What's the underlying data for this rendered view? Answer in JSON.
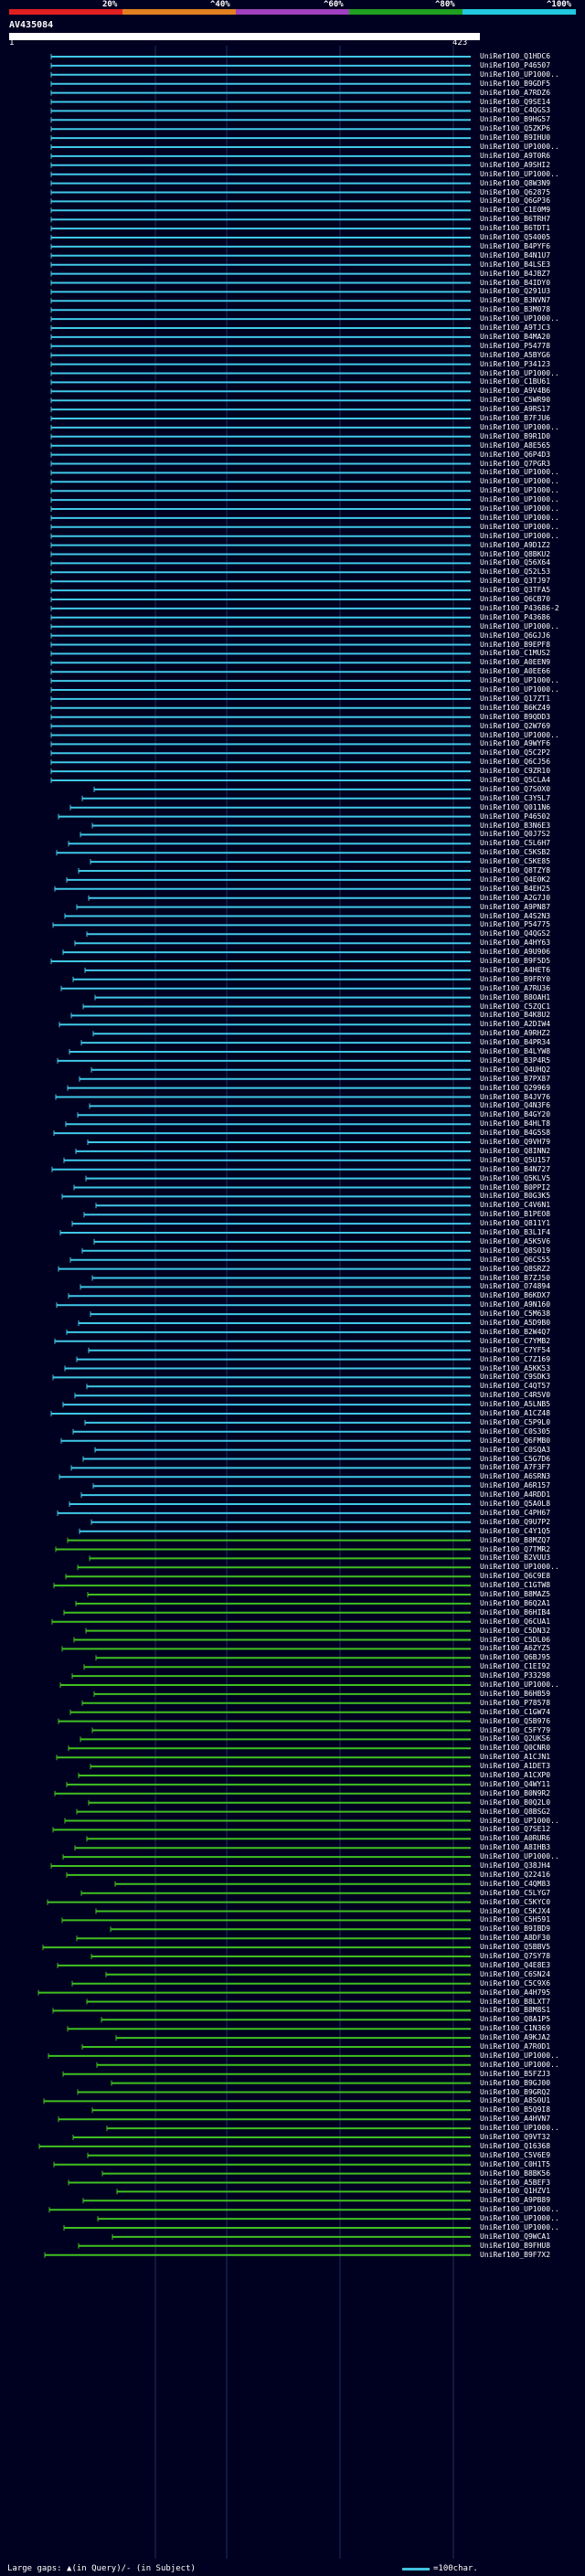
{
  "query": {
    "id": "AV435084",
    "start": "1",
    "end": "423"
  },
  "scale": {
    "ticks": [
      "20%",
      "^40%",
      "^60%",
      "^80%",
      "^100%"
    ]
  },
  "legend": {
    "gaps": "Large gaps: ▲(in Query)/- (in Subject)",
    "scale_note": "=100char."
  },
  "colors": {
    "cyan": "#40c8e8",
    "green": "#40c020",
    "bg": "#000020"
  },
  "hits": [
    "UniRef100_Q1HDC6",
    "UniRef100_P46507",
    "UniRef100_UP1000..",
    "UniRef100_B9GDF5",
    "UniRef100_A7RDZ6",
    "UniRef100_Q9SE14",
    "UniRef100_C4QGS3",
    "UniRef100_B9HG57",
    "UniRef100_Q5ZKP6",
    "UniRef100_B9IHU0",
    "UniRef100_UP1000..",
    "UniRef100_A9T0R6",
    "UniRef100_A9SHI2",
    "UniRef100_UP1000..",
    "UniRef100_Q8W3N9",
    "UniRef100_Q62875",
    "UniRef100_Q6GP36",
    "UniRef100_C1E0M9",
    "UniRef100_B6TRH7",
    "UniRef100_B6TDT1",
    "UniRef100_Q54005",
    "UniRef100_B4PYF6",
    "UniRef100_B4N1U7",
    "UniRef100_B4LSE3",
    "UniRef100_B4JBZ7",
    "UniRef100_B4IDY0",
    "UniRef100_Q291U3",
    "UniRef100_B3NVN7",
    "UniRef100_B3M078",
    "UniRef100_UP1000..",
    "UniRef100_A9TJC3",
    "UniRef100_B4MA20",
    "UniRef100_P54778",
    "UniRef100_A5BYG6",
    "UniRef100_P34123",
    "UniRef100_UP1000..",
    "UniRef100_C1BU61",
    "UniRef100_A9V4B6",
    "UniRef100_C5WR90",
    "UniRef100_A9RS17",
    "UniRef100_B7FJU6",
    "UniRef100_UP1000..",
    "UniRef100_B9R1D0",
    "UniRef100_A8E565",
    "UniRef100_Q6P4D3",
    "UniRef100_Q7PGR3",
    "UniRef100_UP1000..",
    "UniRef100_UP1000..",
    "UniRef100_UP1000..",
    "UniRef100_UP1000..",
    "UniRef100_UP1000..",
    "UniRef100_UP1000..",
    "UniRef100_UP1000..",
    "UniRef100_UP1000..",
    "UniRef100_A9D1Z2",
    "UniRef100_Q8BKU2",
    "UniRef100_Q56X64",
    "UniRef100_Q52L53",
    "UniRef100_Q3TJ97",
    "UniRef100_Q3TFA5",
    "UniRef100_Q6CB70",
    "UniRef100_P43686-2",
    "UniRef100_P43686",
    "UniRef100_UP1000..",
    "UniRef100_Q6GJJ6",
    "UniRef100_B9EPF8",
    "UniRef100_C1MUS2",
    "UniRef100_A0EEN9",
    "UniRef100_A0EE66",
    "UniRef100_UP1000..",
    "UniRef100_UP1000..",
    "UniRef100_Q17ZT1",
    "UniRef100_B6KZ49",
    "UniRef100_B9QDD3",
    "UniRef100_Q2W769",
    "UniRef100_UP1000..",
    "UniRef100_A9WYF6",
    "UniRef100_Q5C2P2",
    "UniRef100_Q6CJ56",
    "UniRef100_C9ZR10",
    "UniRef100_Q5CLA4",
    "UniRef100_Q7S0X0",
    "UniRef100_C3Y5L7",
    "UniRef100_Q011N6",
    "UniRef100_P46502",
    "UniRef100_B3N6E3",
    "UniRef100_Q0J7S2",
    "UniRef100_C5L6H7",
    "UniRef100_C5KSB2",
    "UniRef100_C5KE85",
    "UniRef100_Q8TZY8",
    "UniRef100_Q4E0K2",
    "UniRef100_B4EH25",
    "UniRef100_A2G7J0",
    "UniRef100_A9PN87",
    "UniRef100_A4S2N3",
    "UniRef100_P54775",
    "UniRef100_Q4QGS2",
    "UniRef100_A4HY63",
    "UniRef100_A9U906",
    "UniRef100_B9F5D5",
    "UniRef100_A4HET6",
    "UniRef100_B9FRY0",
    "UniRef100_A7RU36",
    "UniRef100_B8OAH1",
    "UniRef100_C5ZQC1",
    "UniRef100_B4K8U2",
    "UniRef100_A2DIW4",
    "UniRef100_A9RHZ2",
    "UniRef100_B4PR34",
    "UniRef100_B4LYW8",
    "UniRef100_B3P4R5",
    "UniRef100_Q4UHQ2",
    "UniRef100_B7PX87",
    "UniRef100_Q29969",
    "UniRef100_B4JV76",
    "UniRef100_Q4N3F6",
    "UniRef100_B4GY20",
    "UniRef100_B4HLT8",
    "UniRef100_B4G5S8",
    "UniRef100_Q9VH79",
    "UniRef100_Q8INN2",
    "UniRef100_Q5U157",
    "UniRef100_B4N727",
    "UniRef100_Q5KLV5",
    "UniRef100_B0PPI2",
    "UniRef100_B0G3K5",
    "UniRef100_C4V6N1",
    "UniRef100_B1PEO8",
    "UniRef100_Q811Y1",
    "UniRef100_B3L1F4",
    "UniRef100_A5K5V6",
    "UniRef100_Q8S019",
    "UniRef100_Q6CS55",
    "UniRef100_Q8SRZ2",
    "UniRef100_B7ZJ50",
    "UniRef100_O74894",
    "UniRef100_B6KDX7",
    "UniRef100_A9N160",
    "UniRef100_C5M638",
    "UniRef100_A5D9B0",
    "UniRef100_B2W4Q7",
    "UniRef100_C7YMB2",
    "UniRef100_C7YF54",
    "UniRef100_C7Z169",
    "UniRef100_A5KK53",
    "UniRef100_C9SDK3",
    "UniRef100_C4QT57",
    "UniRef100_C4R5V0",
    "UniRef100_A5LNB5",
    "UniRef100_A1CZ48",
    "UniRef100_C5P9L0",
    "UniRef100_C0S305",
    "UniRef100_Q6FMB0",
    "UniRef100_C0SQA3",
    "UniRef100_C5G7D6",
    "UniRef100_A7F3F7",
    "UniRef100_A6SRN3",
    "UniRef100_A6R157",
    "UniRef100_A4RDD1",
    "UniRef100_Q5A0L8",
    "UniRef100_C4PH67",
    "UniRef100_Q9U7P2",
    "UniRef100_C4Y1Q5",
    "UniRef100_B8MZQ7",
    "UniRef100_Q7TMR2",
    "UniRef100_B2VUU3",
    "UniRef100_UP1000..",
    "UniRef100_Q6C9E8",
    "UniRef100_C1GTW8",
    "UniRef100_B8MAZ5",
    "UniRef100_B6Q2A1",
    "UniRef100_B6HIB4",
    "UniRef100_Q6CUA1",
    "UniRef100_C5DN32",
    "UniRef100_C5DL06",
    "UniRef100_A6ZYZ5",
    "UniRef100_Q6BJ95",
    "UniRef100_C1EI92",
    "UniRef100_P33298",
    "UniRef100_UP1000..",
    "UniRef100_B6HB59",
    "UniRef100_P78578",
    "UniRef100_C1GW74",
    "UniRef100_Q5B976",
    "UniRef100_C5FY79",
    "UniRef100_Q2UKS6",
    "UniRef100_Q0CNR0",
    "UniRef100_A1CJN1",
    "UniRef100_A1DET3",
    "UniRef100_A1CXP0",
    "UniRef100_Q4WY11",
    "UniRef100_B0N9R2",
    "UniRef100_B0Q2L0",
    "UniRef100_Q8BSG2",
    "UniRef100_UP1000..",
    "UniRef100_Q7SE12",
    "UniRef100_A0RUR6",
    "UniRef100_A8IHB3",
    "UniRef100_UP1000..",
    "UniRef100_Q38JH4",
    "UniRef100_Q22416",
    "UniRef100_C4QM83",
    "UniRef100_C5LYG7",
    "UniRef100_C5KYC0",
    "UniRef100_C5KJX4",
    "UniRef100_C5H591",
    "UniRef100_B9IBD9",
    "UniRef100_A8DF30",
    "UniRef100_Q5BBV5",
    "UniRef100_Q7SY78",
    "UniRef100_Q4E8E3",
    "UniRef100_C6SN24",
    "UniRef100_C5C9X6",
    "UniRef100_A4H795",
    "UniRef100_B8LXT7",
    "UniRef100_B8M8S1",
    "UniRef100_Q8A1P5",
    "UniRef100_C1N369",
    "UniRef100_A9KJA2",
    "UniRef100_A7R0D1",
    "UniRef100_UP1000..",
    "UniRef100_UP1000..",
    "UniRef100_B5FZJ3",
    "UniRef100_B9GJ00",
    "UniRef100_B9GRQ2",
    "UniRef100_A8S0U1",
    "UniRef100_B5Q9I8",
    "UniRef100_A4HVN7",
    "UniRef100_UP1000..",
    "UniRef100_Q9VT32",
    "UniRef100_Q16368",
    "UniRef100_C5V6E9",
    "UniRef100_C0H1T5",
    "UniRef100_B8BK56",
    "UniRef100_A5BEF3",
    "UniRef100_Q1HZV1",
    "UniRef100_A9PB89",
    "UniRef100_UP1000..",
    "UniRef100_UP1000..",
    "UniRef100_UP1000..",
    "UniRef100_Q9WCA1",
    "UniRef100_B9FHU8",
    "UniRef100_B9F7X2"
  ]
}
